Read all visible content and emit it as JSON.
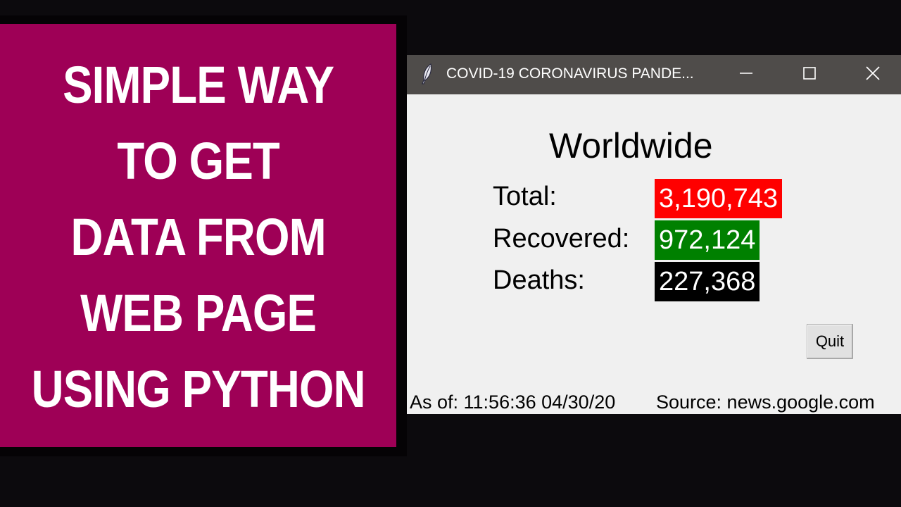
{
  "promo": {
    "lines": [
      "SIMPLE WAY",
      "TO GET",
      "DATA FROM",
      "WEB PAGE",
      "USING PYTHON"
    ],
    "background_color": "#9e0056",
    "text_color": "#ffffff"
  },
  "window": {
    "title": "COVID-19 CORONAVIRUS PANDE...",
    "icon": "feather-icon",
    "controls": {
      "minimize": "minimize-icon",
      "maximize": "maximize-icon",
      "close": "close-icon"
    },
    "titlebar_color": "#4f4c4a"
  },
  "content": {
    "heading": "Worldwide",
    "stats": [
      {
        "label": "Total:",
        "value": "3,190,743",
        "color": "#ff0000"
      },
      {
        "label": "Recovered:",
        "value": "972,124",
        "color": "#008000"
      },
      {
        "label": "Deaths:",
        "value": "227,368",
        "color": "#000000"
      }
    ],
    "quit_label": "Quit",
    "as_of": "As of: 11:56:36 04/30/20",
    "source": "Source: news.google.com"
  }
}
